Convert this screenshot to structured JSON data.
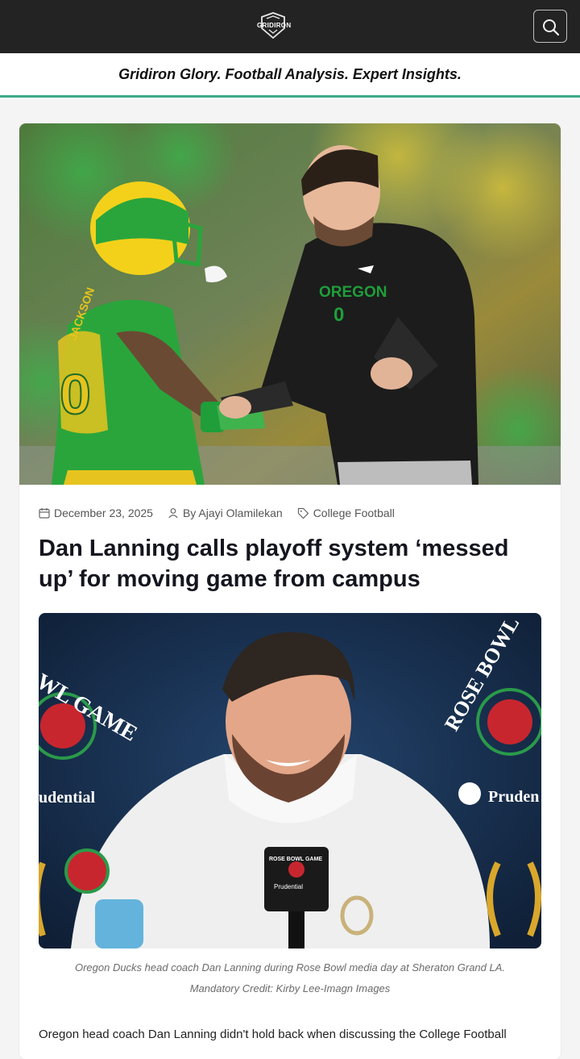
{
  "header": {
    "logo_text": "GRIDIRON",
    "search_icon": "search-icon"
  },
  "tagline": "Gridiron Glory. Football Analysis. Expert Insights.",
  "colors": {
    "header_bg": "#232323",
    "accent": "#3bab8a",
    "oregon_green": "#1f9e3a",
    "oregon_yellow": "#f3d11b"
  },
  "article": {
    "hero_image": "Oregon player in green jersey shaking hands with coach in black Oregon sweatshirt",
    "date": "December 23, 2025",
    "author": "By Ajayi Olamilekan",
    "category": "College Football",
    "icons": {
      "date": "calendar-icon",
      "author": "user-icon",
      "category": "tag-icon"
    },
    "title": "Dan Lanning calls playoff system ‘messed up’ for moving game from campus",
    "inline_image": "Dan Lanning at Rose Bowl media day podium",
    "image_text": {
      "left_banner": "WL GAME",
      "left_sponsor": "udential",
      "right_banner": "ROSE BOWL",
      "right_sponsor": "Pruden",
      "mic_flag": "ROSE BOWL GAME",
      "mic_sponsor": "Prudential"
    },
    "caption_line1": "Oregon Ducks head coach Dan Lanning during Rose Bowl media day at Sheraton Grand LA.",
    "caption_line2": "Mandatory Credit: Kirby Lee-Imagn Images",
    "body_start": "Oregon head coach Dan Lanning didn't hold back when discussing the College Football"
  }
}
